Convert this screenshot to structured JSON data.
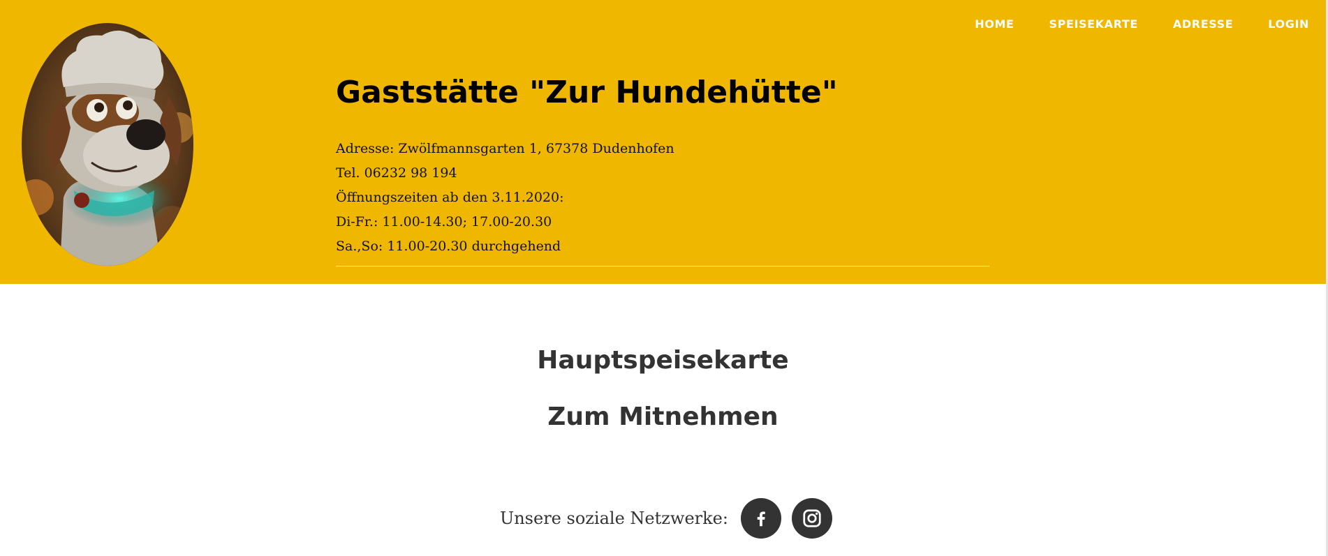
{
  "nav": {
    "items": [
      {
        "label": "HOME"
      },
      {
        "label": "SPEISEKARTE"
      },
      {
        "label": "ADRESSE"
      },
      {
        "label": "LOGIN"
      }
    ]
  },
  "header": {
    "logo_icon": "dog-chef-mascot-photo",
    "title": "Gaststätte \"Zur Hundehütte\"",
    "info_lines": [
      "Adresse: Zwölfmannsgarten 1, 67378 Dudenhofen",
      "Tel. 06232 98 194",
      "Öffnungszeiten ab den 3.11.2020:",
      "Di-Fr.: 11.00-14.30; 17.00-20.30",
      "Sa.,So: 11.00-20.30 durchgehend"
    ]
  },
  "main": {
    "headings": [
      "Hauptspeisekarte",
      "Zum Mitnehmen"
    ]
  },
  "social": {
    "label": "Unsere soziale Netzwerke:",
    "icons": [
      "facebook-icon",
      "instagram-icon"
    ]
  },
  "colors": {
    "header_bg": "#f0b700",
    "nav_text": "#ffffff",
    "heading_text": "#333333",
    "social_button": "#333333"
  }
}
